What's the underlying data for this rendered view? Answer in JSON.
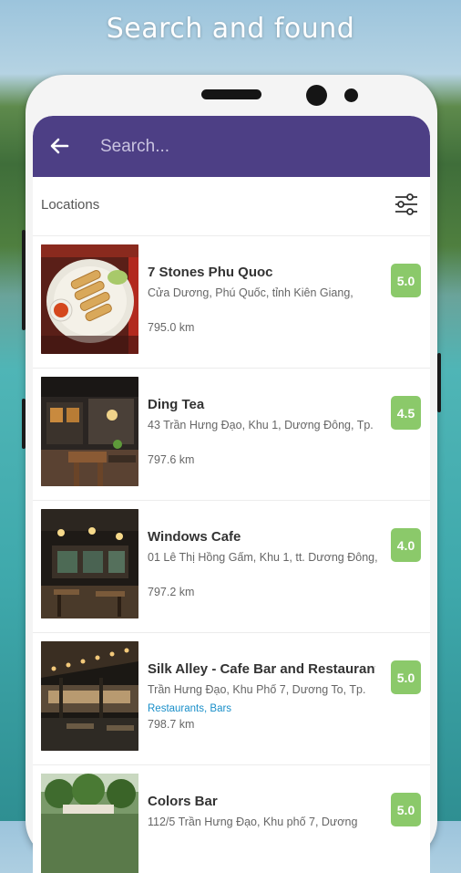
{
  "hero": {
    "title": "Search and found"
  },
  "search": {
    "placeholder": "Search..."
  },
  "section": {
    "label": "Locations"
  },
  "icons": {
    "back": "arrow-left-icon",
    "filter": "sliders-icon"
  },
  "colors": {
    "appbar": "#4d3f85",
    "rating_badge": "#8bc96a",
    "tag_link": "#1a8fc9"
  },
  "locations": [
    {
      "name": "7 Stones Phu Quoc",
      "address": "Cửa Dương, Phú Quốc, tỉnh Kiên Giang,",
      "tags": "",
      "distance": "795.0 km",
      "rating": "5.0"
    },
    {
      "name": "Ding Tea",
      "address": "43 Trần Hưng Đạo, Khu 1, Dương Đông, Tp.",
      "tags": "",
      "distance": "797.6 km",
      "rating": "4.5"
    },
    {
      "name": "Windows Cafe",
      "address": "01 Lê Thị Hồng Gấm, Khu 1, tt. Dương Đông,",
      "tags": "",
      "distance": "797.2 km",
      "rating": "4.0"
    },
    {
      "name": "Silk Alley - Cafe Bar and Restaurant",
      "address": "Trần Hưng Đạo, Khu Phố 7, Dương To, Tp.",
      "tags": "Restaurants, Bars",
      "distance": "798.7 km",
      "rating": "5.0"
    },
    {
      "name": "Colors Bar",
      "address": "112/5 Trần Hưng Đạo, Khu phố 7, Dương",
      "tags": "",
      "distance": "",
      "rating": "5.0"
    }
  ]
}
